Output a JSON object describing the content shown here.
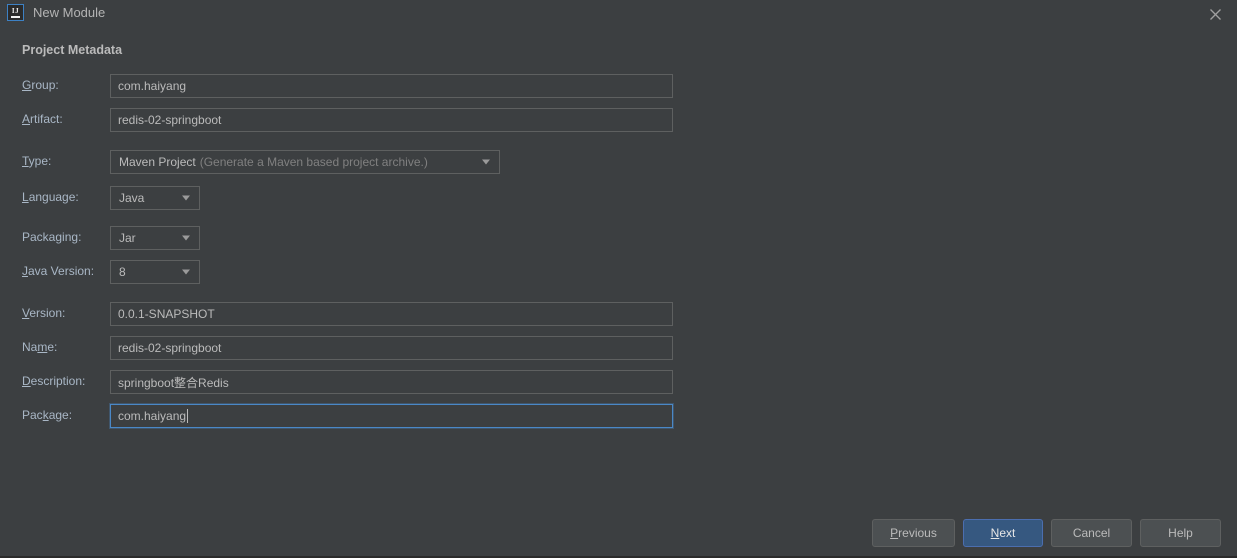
{
  "window": {
    "title": "New Module",
    "app_icon": "intellij-idea-icon",
    "icon_letters": "IJ",
    "close_icon": "close-icon",
    "background_color": "#3c3f41"
  },
  "section": {
    "title": "Project Metadata"
  },
  "fields": {
    "group": {
      "label": "Group:",
      "mnemonic": "G",
      "value": "com.haiyang"
    },
    "artifact": {
      "label": "Artifact:",
      "mnemonic": "A",
      "value": "redis-02-springboot"
    },
    "type": {
      "label": "Type:",
      "mnemonic": "T",
      "value": "Maven Project",
      "description": "(Generate a Maven based project archive.)",
      "dropdown_icon": "chevron-down-icon"
    },
    "language": {
      "label": "Language:",
      "mnemonic": "L",
      "value": "Java",
      "dropdown_icon": "chevron-down-icon"
    },
    "packaging": {
      "label": "Packaging:",
      "mnemonic": "g",
      "value": "Jar",
      "dropdown_icon": "chevron-down-icon"
    },
    "java_version": {
      "label": "Java Version:",
      "mnemonic": "J",
      "value": "8",
      "dropdown_icon": "chevron-down-icon"
    },
    "version": {
      "label": "Version:",
      "mnemonic": "V",
      "value": "0.0.1-SNAPSHOT"
    },
    "name": {
      "label": "Name:",
      "mnemonic": "m",
      "value": "redis-02-springboot"
    },
    "description": {
      "label": "Description:",
      "mnemonic": "D",
      "value": "springboot整合Redis"
    },
    "package": {
      "label": "Package:",
      "mnemonic": "k",
      "value": "com.haiyang",
      "focused": true
    }
  },
  "buttons": {
    "previous": {
      "label": "Previous",
      "mnemonic": "P"
    },
    "next": {
      "label": "Next",
      "mnemonic": "N",
      "default": true,
      "color": "#365880"
    },
    "cancel": {
      "label": "Cancel"
    },
    "help": {
      "label": "Help"
    }
  }
}
